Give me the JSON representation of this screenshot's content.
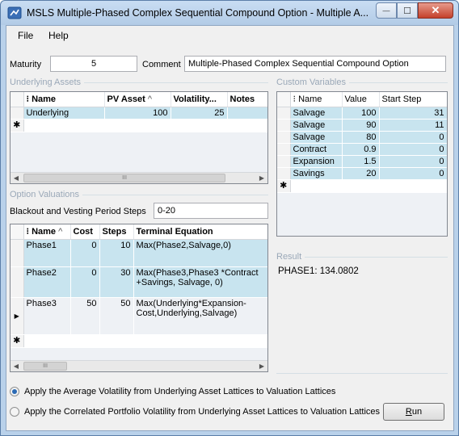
{
  "window": {
    "title": "MSLS Multiple-Phased Complex Sequential Compound Option - Multiple A...",
    "min_glyph": "—",
    "max_glyph": "☐",
    "close_glyph": "✕"
  },
  "menu": {
    "file": "File",
    "help": "Help"
  },
  "maturity": {
    "label": "Maturity",
    "value": "5"
  },
  "comment": {
    "label": "Comment",
    "value": "Multiple-Phased Complex Sequential Compound Option"
  },
  "underlying_assets": {
    "group_title": "Underlying Assets",
    "headers": {
      "name": "Name",
      "pv_asset": "PV Asset",
      "volatility": "Volatility...",
      "notes": "Notes"
    },
    "rows": [
      {
        "name": "Underlying",
        "pv_asset": "100",
        "volatility": "25",
        "notes": ""
      }
    ],
    "new_row_marker": "✱",
    "sort_glyph": "^"
  },
  "custom_variables": {
    "group_title": "Custom Variables",
    "headers": {
      "name": "Name",
      "value": "Value",
      "start_step": "Start Step"
    },
    "rows": [
      {
        "name": "Salvage",
        "value": "100",
        "start_step": "31"
      },
      {
        "name": "Salvage",
        "value": "90",
        "start_step": "11"
      },
      {
        "name": "Salvage",
        "value": "80",
        "start_step": "0"
      },
      {
        "name": "Contract",
        "value": "0.9",
        "start_step": "0"
      },
      {
        "name": "Expansion",
        "value": "1.5",
        "start_step": "0"
      },
      {
        "name": "Savings",
        "value": "20",
        "start_step": "0"
      }
    ],
    "new_row_marker": "✱"
  },
  "option_valuations": {
    "group_title": "Option Valuations",
    "blackout_label": "Blackout and Vesting Period Steps",
    "blackout_value": "0-20",
    "headers": {
      "name": "Name",
      "cost": "Cost",
      "steps": "Steps",
      "terminal_equation": "Terminal Equation"
    },
    "rows": [
      {
        "name": "Phase1",
        "cost": "0",
        "steps": "10",
        "terminal_equation": "Max(Phase2,Salvage,0)"
      },
      {
        "name": "Phase2",
        "cost": "0",
        "steps": "30",
        "terminal_equation": "Max(Phase3,Phase3 *Contract +Savings, Salvage, 0)"
      },
      {
        "name": "Phase3",
        "cost": "50",
        "steps": "50",
        "terminal_equation": "Max(Underlying*Expansion-Cost,Underlying,Salvage)"
      }
    ],
    "current_row_marker": "▶",
    "new_row_marker": "✱",
    "sort_glyph": "^"
  },
  "result": {
    "group_title": "Result",
    "text": "PHASE1: 134.0802"
  },
  "options": {
    "average_volatility": "Apply the Average Volatility from Underlying Asset Lattices to Valuation Lattices",
    "correlated_volatility": "Apply the Correlated Portfolio Volatility from Underlying Asset Lattices to Valuation Lattices",
    "selected": "average_volatility"
  },
  "run_button": {
    "label": "Run",
    "mnemonic": "R",
    "rest": "un"
  },
  "scrollbar": {
    "left": "◀",
    "right": "▶",
    "thumb_grip": "III"
  }
}
